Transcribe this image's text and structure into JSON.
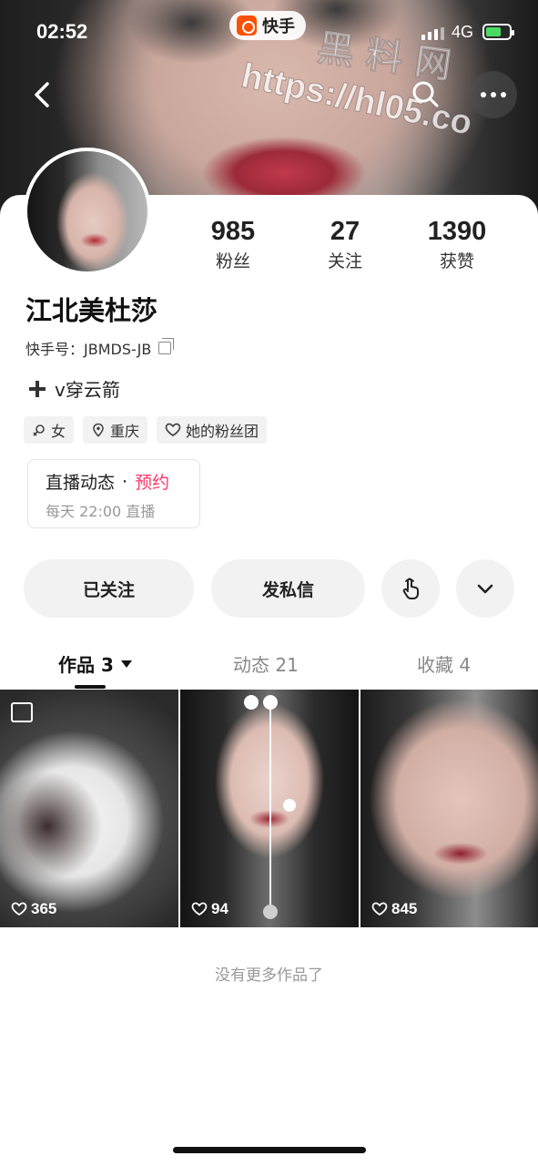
{
  "status_bar": {
    "time": "02:52",
    "network": "4G",
    "app_badge": "快手"
  },
  "watermark": {
    "line1": "黑 料 网",
    "line2": "https://hl05.co"
  },
  "header": {
    "back_icon": "chevron-left-icon",
    "search_icon": "search-icon",
    "more_icon": "more-dots-icon"
  },
  "profile": {
    "name": "江北美杜莎",
    "kuaishou_id_label": "快手号：",
    "kuaishou_id": "JBMDS-JB",
    "bio": "v穿云箭",
    "stats": [
      {
        "value": "985",
        "label": "粉丝"
      },
      {
        "value": "27",
        "label": "关注"
      },
      {
        "value": "1390",
        "label": "获赞"
      }
    ],
    "tags": [
      {
        "icon": "female-icon",
        "label": "女"
      },
      {
        "icon": "location-pin-icon",
        "label": "重庆"
      },
      {
        "icon": "heart-outline-icon",
        "label": "她的粉丝团"
      }
    ]
  },
  "live": {
    "title": "直播动态",
    "separator": "·",
    "action": "预约",
    "schedule": "每天 22:00 直播"
  },
  "actions": {
    "followed": "已关注",
    "message": "发私信",
    "gesture_icon": "pointer-hand-icon",
    "expand_icon": "chevron-down-icon"
  },
  "tabs": [
    {
      "label": "作品 3",
      "active": true
    },
    {
      "label": "动态 21",
      "active": false
    },
    {
      "label": "收藏 4",
      "active": false
    }
  ],
  "works": [
    {
      "likes": "365",
      "type": "image-set"
    },
    {
      "likes": "94",
      "type": "video"
    },
    {
      "likes": "845",
      "type": "video"
    }
  ],
  "footer": {
    "no_more": "没有更多作品了"
  },
  "colors": {
    "accent": "#fe3666",
    "button_bg": "#f2f2f2",
    "brand": "#ff5000"
  }
}
